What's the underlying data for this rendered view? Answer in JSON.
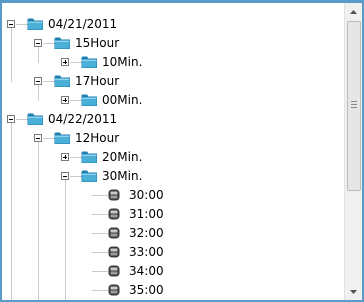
{
  "tree": {
    "nodes": [
      {
        "label": "04/21/2011",
        "kind": "folder",
        "state": "expanded",
        "level": 0
      },
      {
        "label": "15Hour",
        "kind": "folder",
        "state": "expanded",
        "level": 1
      },
      {
        "label": "10Min.",
        "kind": "folder",
        "state": "collapsed",
        "level": 2
      },
      {
        "label": "17Hour",
        "kind": "folder",
        "state": "expanded",
        "level": 1
      },
      {
        "label": "00Min.",
        "kind": "folder",
        "state": "collapsed",
        "level": 2
      },
      {
        "label": "04/22/2011",
        "kind": "folder",
        "state": "expanded",
        "level": 0
      },
      {
        "label": "12Hour",
        "kind": "folder",
        "state": "expanded",
        "level": 1
      },
      {
        "label": "20Min.",
        "kind": "folder",
        "state": "collapsed",
        "level": 2
      },
      {
        "label": "30Min.",
        "kind": "folder",
        "state": "expanded",
        "level": 2
      },
      {
        "label": "30:00",
        "kind": "recording",
        "level": 3
      },
      {
        "label": "31:00",
        "kind": "recording",
        "level": 3
      },
      {
        "label": "32:00",
        "kind": "recording",
        "level": 3
      },
      {
        "label": "33:00",
        "kind": "recording",
        "level": 3
      },
      {
        "label": "34:00",
        "kind": "recording",
        "level": 3
      },
      {
        "label": "35:00",
        "kind": "recording",
        "level": 3
      }
    ]
  },
  "icons": {
    "folder": "folder-icon",
    "recording": "recording-file-icon",
    "scroll_up": "arrow-up-icon",
    "scroll_down": "arrow-down-icon"
  },
  "colors": {
    "window_border": "#5a9cc7",
    "folder_fill": "#4bb0d8",
    "folder_dark": "#1e7fb0",
    "tree_line": "#9a9a9a"
  }
}
